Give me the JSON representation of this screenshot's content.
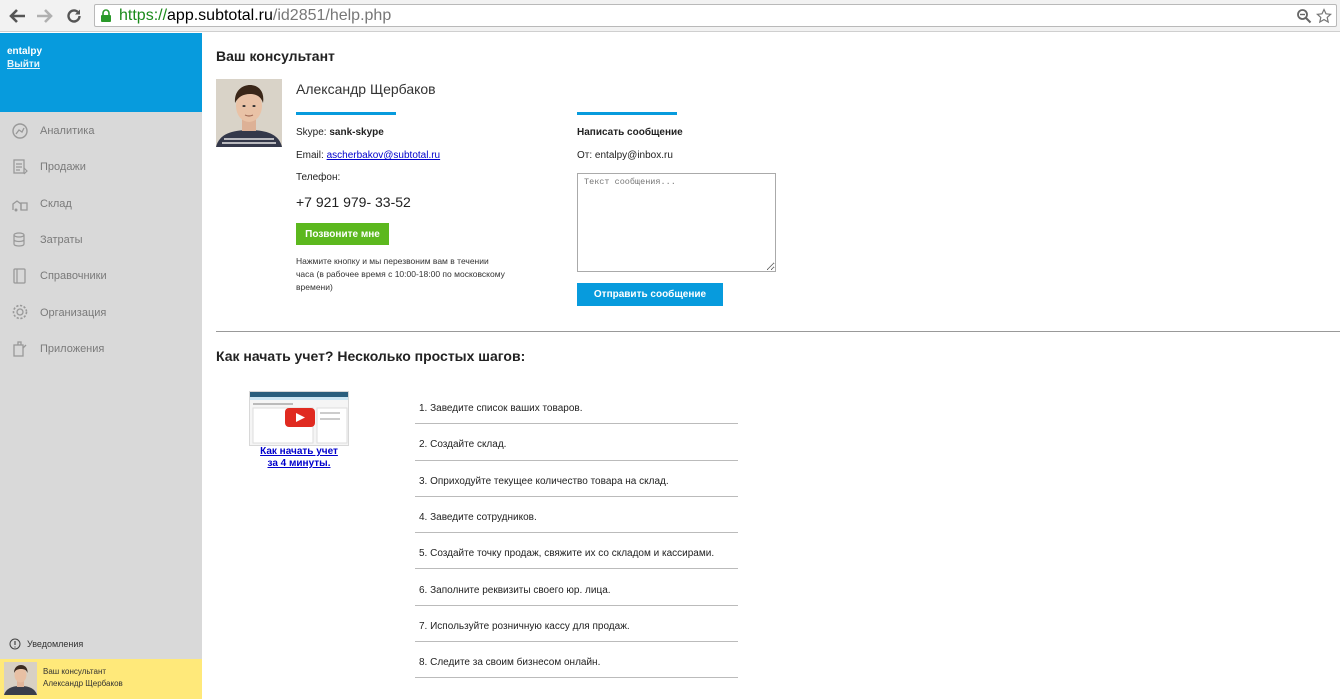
{
  "browser": {
    "url_proto": "https://",
    "url_host": "app.subtotal.ru",
    "url_path": "/id2851/help.php"
  },
  "sidebar": {
    "user_name": "entalpy",
    "logout_label": "Выйти",
    "items": [
      {
        "label": "Аналитика",
        "icon": "analytics-icon"
      },
      {
        "label": "Продажи",
        "icon": "sales-icon"
      },
      {
        "label": "Склад",
        "icon": "warehouse-icon"
      },
      {
        "label": "Затраты",
        "icon": "expenses-icon"
      },
      {
        "label": "Справочники",
        "icon": "reference-book-icon"
      },
      {
        "label": "Организация",
        "icon": "gear-icon"
      },
      {
        "label": "Приложения",
        "icon": "apps-icon"
      }
    ],
    "notifications_label": "Уведомления",
    "consultant_box": {
      "line1": "Ваш консультант",
      "line2": "Александр Щербаков"
    }
  },
  "consultant": {
    "heading": "Ваш консультант",
    "name": "Александр Щербаков",
    "skype_label": "Skype:",
    "skype_value": "sank-skype",
    "email_label": "Email:",
    "email_value": "ascherbakov@subtotal.ru",
    "phone_label": "Телефон:",
    "phone_value": "+7 921 979- 33-52",
    "call_button": "Позвоните мне",
    "call_note": "Нажмите кнопку и мы перезвоним вам в течении часа (в рабочее время с 10:00-18:00 по московскому времени)"
  },
  "message": {
    "heading": "Написать сообщение",
    "from_label": "От:",
    "from_value": "entalpy@inbox.ru",
    "placeholder": "Текст сообщения...",
    "send_button": "Отправить сообщение"
  },
  "getting_started": {
    "heading": "Как начать учет? Несколько простых шагов:",
    "video_link_line1": "Как начать учет",
    "video_link_line2": "за 4 минуты.",
    "steps": [
      "1. Заведите список ваших товаров.",
      "2. Создайте склад.",
      "3. Оприходуйте текущее количество товара на склад.",
      "4. Заведите сотрудников.",
      "5. Создайте точку продаж, свяжите их со складом и кассирами.",
      "6. Заполните реквизиты своего юр. лица.",
      "7. Используйте розничную кассу для продаж.",
      "8. Следите за своим бизнесом онлайн."
    ]
  },
  "colors": {
    "brand_blue": "#079bdd",
    "call_green": "#5cb81e",
    "consultant_yellow": "#ffe97a",
    "sidebar_gray": "#d9d9d9"
  }
}
